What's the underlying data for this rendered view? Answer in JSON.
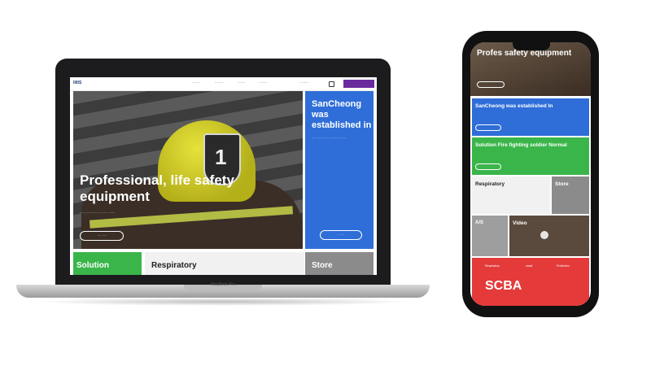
{
  "laptop": {
    "brand": "MacBook Pro",
    "site": {
      "logo": "IIIIIS",
      "nav": [
        "·········",
        "··········",
        "········",
        "·········",
        "··········"
      ],
      "hero": {
        "title": "Professional, life safety equipment",
        "subtitle": "·····, ·············· ······· ········",
        "button": "···· ····"
      },
      "blue_card": {
        "title": "SanCheong was established in",
        "subtitle": "···· ·· ······· ···· ······· ·· ·····",
        "button": "··· ····"
      },
      "bottom_tiles": [
        "Solution",
        "Respiratory",
        "Store"
      ]
    }
  },
  "phone": {
    "hero": {
      "title": "Profes safety equipment"
    },
    "cards": {
      "blue": "SanCheong was established In",
      "green": "Solution Fire fighting soldier Normal",
      "respiratory": "Respiratory",
      "store": "Store",
      "as": "A/S",
      "video": "Video"
    },
    "red_banner": {
      "tabs": [
        "Respiratory",
        "mask",
        "Protection"
      ],
      "title": "SCBA"
    }
  },
  "colors": {
    "blue": "#2f6ed8",
    "green": "#3ab54a",
    "red": "#e43a3a",
    "purple": "#6a2a9e"
  }
}
